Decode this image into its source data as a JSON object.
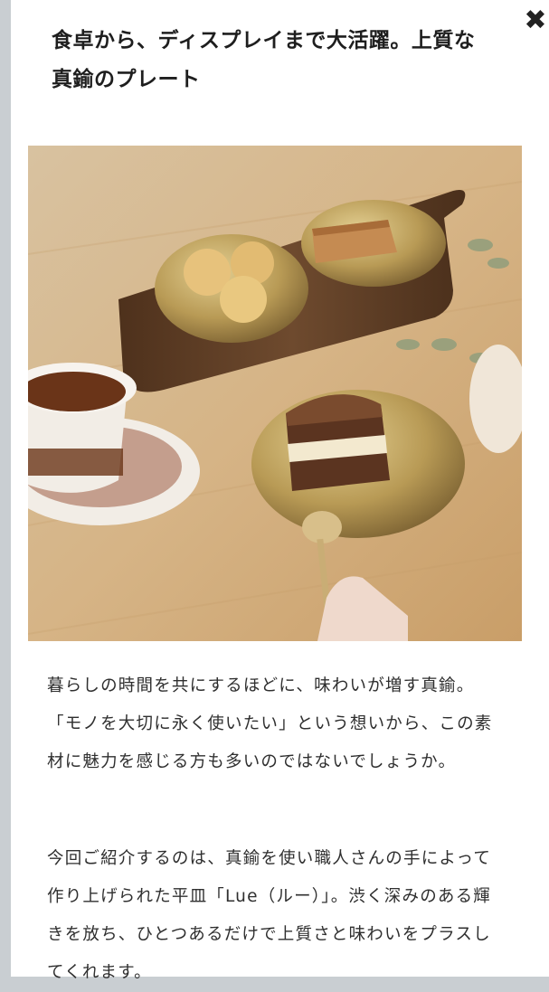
{
  "modal": {
    "close_icon": "close-icon",
    "close_glyph": "✖",
    "title": "食卓から、ディスプレイまで大活躍。上質な真鍮のプレート"
  },
  "article": {
    "paragraphs": [
      "暮らしの時間を共にするほどに、味わいが増す真鍮。「モノを大切に永く使いたい」という想いから、この素材に魅力を感じる方も多いのではないでしょうか。",
      "今回ご紹介するのは、真鍮を使い職人さんの手によって作り上げられた平皿「Lue（ルー）」。渋く深みのある輝きを放ち、ひとつあるだけで上質さと味わいをプラスしてくれます。"
    ]
  },
  "colors": {
    "table_wood": "#d9b98a",
    "brass": "#b89a55",
    "board": "#6e4a2e"
  }
}
